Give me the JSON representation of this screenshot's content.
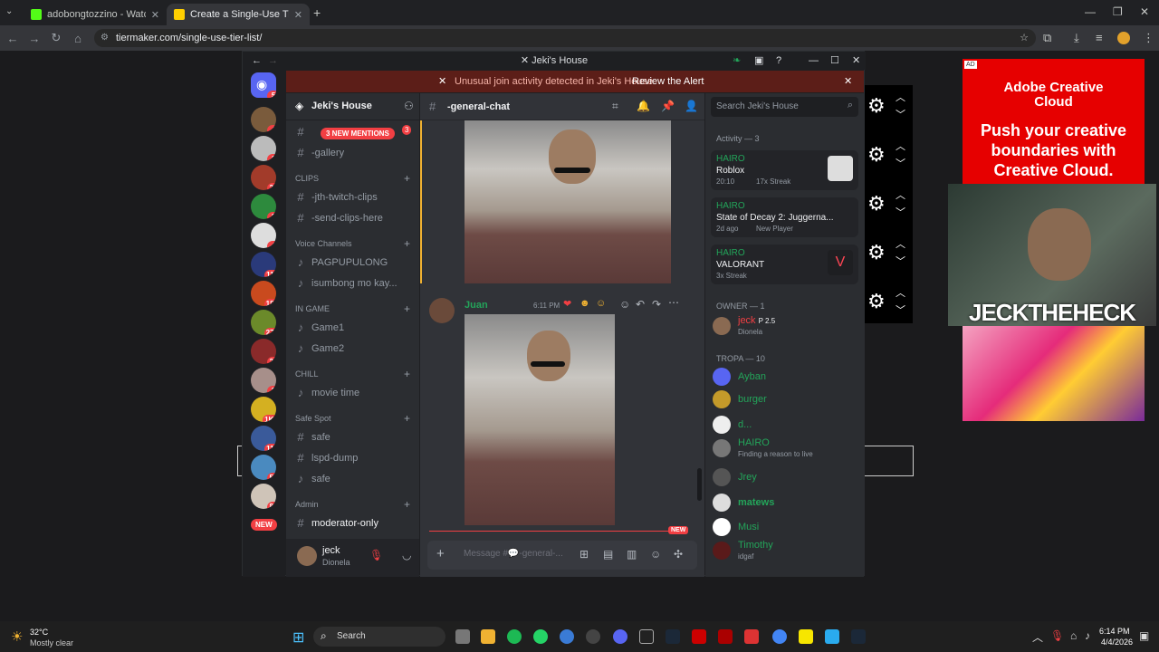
{
  "browser": {
    "tabs": [
      {
        "title": "adobongtozzino - Watch the V"
      },
      {
        "title": "Create a Single-Use Tier List (P"
      }
    ],
    "url": "tiermaker.com/single-use-tier-list/"
  },
  "discord": {
    "window_title": "Jeki's House",
    "alert": {
      "text": "Unusual join activity detected in Jeki's House",
      "action": "Review the Alert"
    },
    "server_name": "Jeki's House",
    "channel_header": "-general-chat",
    "search_placeholder": "Search Jeki's House",
    "new_mentions": "3 NEW MENTIONS",
    "guild_badges": [
      "5",
      "4",
      "1",
      "23",
      "3",
      "4",
      "114",
      "185",
      "271",
      "29",
      "2",
      "1K+",
      "114",
      "54",
      "89",
      "119"
    ],
    "new_pill": "NEW",
    "channels": {
      "gallery": "-gallery",
      "clips_cat": "CLIPS",
      "jth_twitch": "-jth-twitch-clips",
      "send_clips": "-send-clips-here",
      "voice_cat": "Voice Channels",
      "pagpupulong": "PAGPUPULONG",
      "isumbong": "isumbong mo kay...",
      "ingame_cat": "IN GAME",
      "game1": "Game1",
      "game2": "Game2",
      "chill_cat": "CHILL",
      "movie": "movie time",
      "safespot_cat": "Safe Spot",
      "safe1": "safe",
      "lspd": "lspd-dump",
      "safe2": "safe",
      "admin_cat": "Admin",
      "modonly": "moderator-only"
    },
    "user": {
      "name": "jeck",
      "status": "Dionela"
    },
    "message": {
      "author": "Juan",
      "time": "6:11 PM"
    },
    "composer_placeholder": "Message #💬-general-...",
    "new_divider": "NEW",
    "activity_header": "Activity — 3",
    "activity": [
      {
        "user": "HAIRO",
        "game": "Roblox",
        "meta": "20:10",
        "streak": "17x Streak"
      },
      {
        "user": "HAIRO",
        "game": "State of Decay 2: Juggerna...",
        "meta": "2d ago",
        "streak": "New Player"
      },
      {
        "user": "HAIRO",
        "game": "VALORANT",
        "meta": "",
        "streak": "3x Streak"
      }
    ],
    "owner_header": "OWNER — 1",
    "owner": {
      "name": "jeck",
      "tag": "P 2.5",
      "status": "Dionela"
    },
    "tropa_header": "TROPA — 10",
    "tropa": [
      {
        "name": "Ayban",
        "status": ""
      },
      {
        "name": "burger",
        "status": ""
      },
      {
        "name": "d...",
        "status": ""
      },
      {
        "name": "HAIRO",
        "status": "Finding a reason to live"
      },
      {
        "name": "Jrey",
        "status": ""
      },
      {
        "name": "matews",
        "status": ""
      },
      {
        "name": "Musi",
        "status": ""
      },
      {
        "name": "Timothy",
        "status": "idgaf"
      }
    ]
  },
  "ad": {
    "brand": "Adobe Creative Cloud",
    "tagline": "Push your creative boundaries with Creative Cloud."
  },
  "overlay": {
    "name": "JECKTHEHECK"
  },
  "taskbar": {
    "weather_temp": "32°C",
    "weather_text": "Mostly clear",
    "search": "Search",
    "time": "6:14 PM",
    "date": "4/4/2026"
  }
}
